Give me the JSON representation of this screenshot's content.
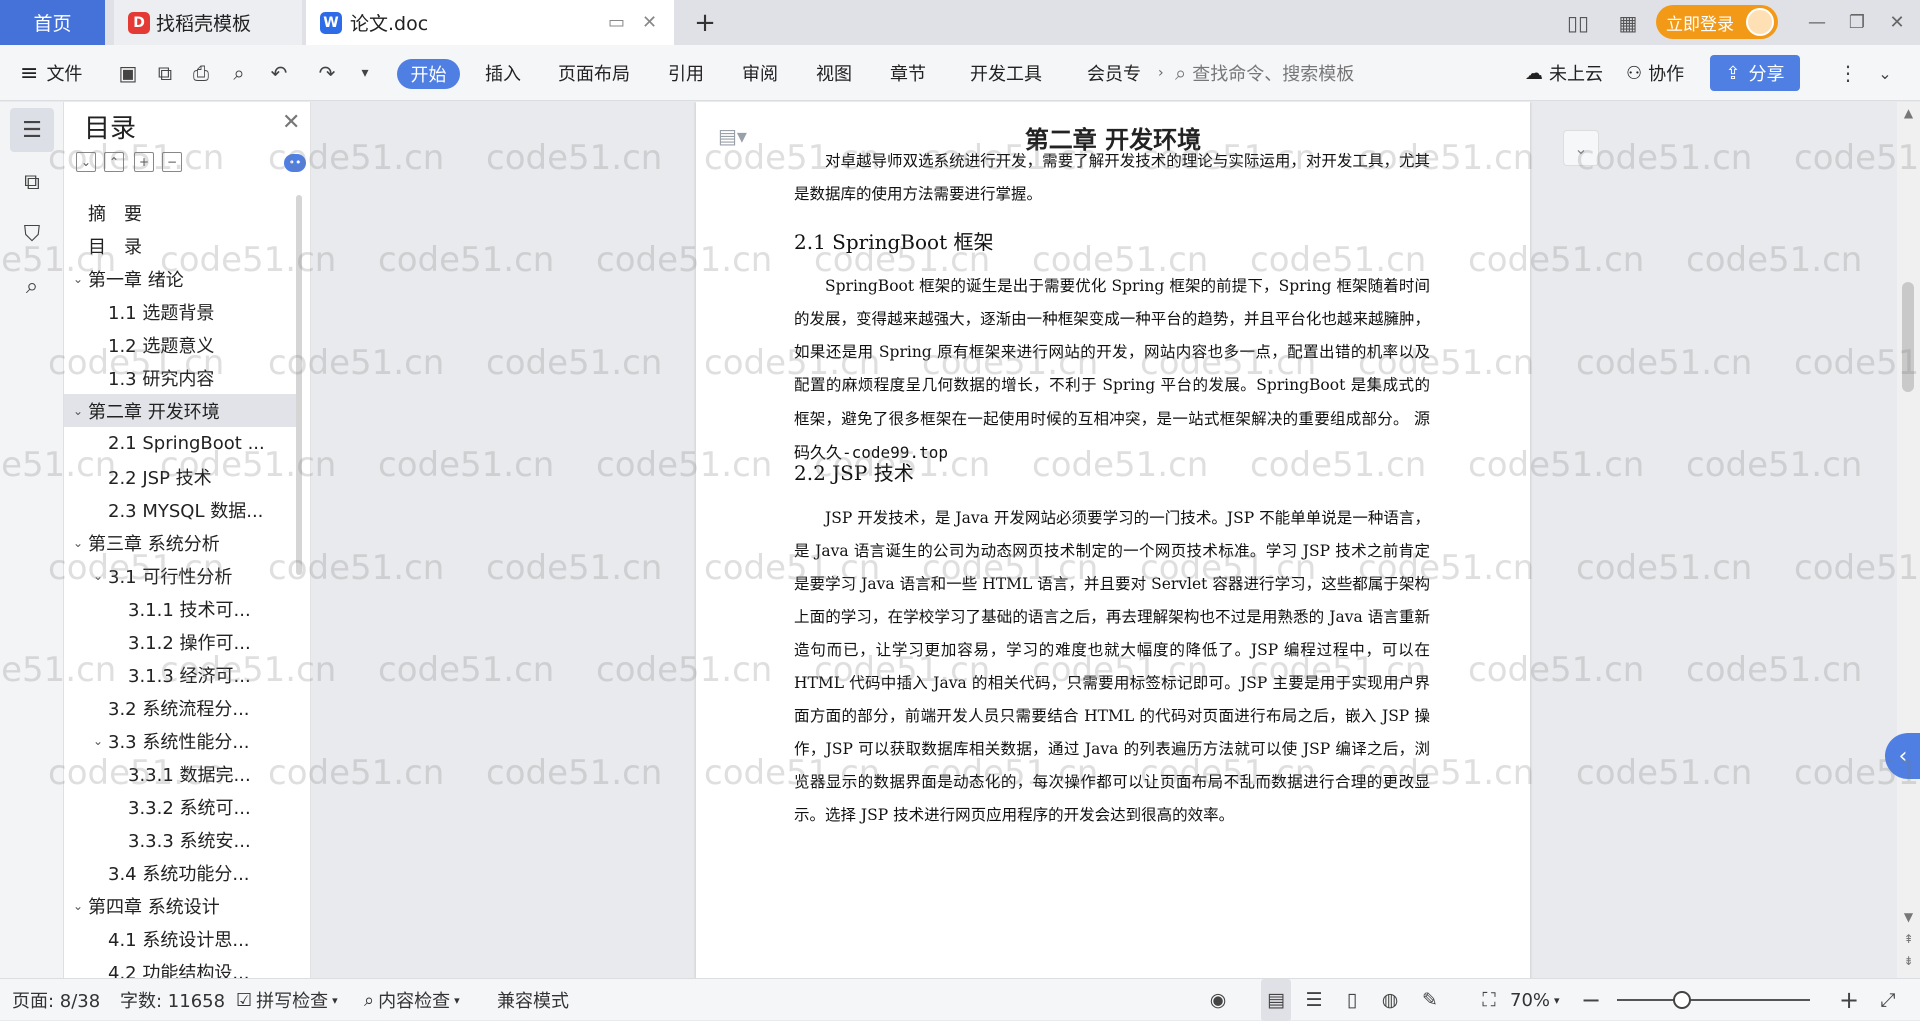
{
  "tabs": {
    "home": "首页",
    "template": "找稻壳模板",
    "doc": "论文.doc",
    "new_tab": "+",
    "login": "立即登录"
  },
  "ribbon": {
    "file": "文件",
    "tabs": [
      "开始",
      "插入",
      "页面布局",
      "引用",
      "审阅",
      "视图",
      "章节",
      "开发工具",
      "会员专"
    ],
    "search_placeholder": "查找命令、搜索模板",
    "cloud": "未上云",
    "collab": "协作",
    "share": "分享"
  },
  "toc": {
    "title": "目录",
    "items": [
      {
        "label": "摘　要",
        "level": 0,
        "caret": ""
      },
      {
        "label": "目　录",
        "level": 0,
        "caret": ""
      },
      {
        "label": "第一章 绪论",
        "level": 0,
        "caret": "v"
      },
      {
        "label": "1.1 选题背景",
        "level": 1,
        "caret": ""
      },
      {
        "label": "1.2 选题意义",
        "level": 1,
        "caret": ""
      },
      {
        "label": "1.3 研究内容",
        "level": 1,
        "caret": ""
      },
      {
        "label": "第二章 开发环境",
        "level": 0,
        "caret": "v",
        "selected": true
      },
      {
        "label": "2.1 SpringBoot ...",
        "level": 1,
        "caret": ""
      },
      {
        "label": "2.2 JSP 技术",
        "level": 1,
        "caret": ""
      },
      {
        "label": "2.3 MYSQL 数据...",
        "level": 1,
        "caret": ""
      },
      {
        "label": "第三章 系统分析",
        "level": 0,
        "caret": "v"
      },
      {
        "label": "3.1 可行性分析",
        "level": 1,
        "caret": "v"
      },
      {
        "label": "3.1.1 技术可...",
        "level": 2,
        "caret": ""
      },
      {
        "label": "3.1.2 操作可...",
        "level": 2,
        "caret": ""
      },
      {
        "label": "3.1.3 经济可...",
        "level": 2,
        "caret": ""
      },
      {
        "label": "3.2 系统流程分...",
        "level": 1,
        "caret": ""
      },
      {
        "label": "3.3 系统性能分...",
        "level": 1,
        "caret": "v"
      },
      {
        "label": "3.3.1 数据完...",
        "level": 2,
        "caret": ""
      },
      {
        "label": "3.3.2 系统可...",
        "level": 2,
        "caret": ""
      },
      {
        "label": "3.3.3 系统安...",
        "level": 2,
        "caret": ""
      },
      {
        "label": "3.4 系统功能分...",
        "level": 1,
        "caret": ""
      },
      {
        "label": "第四章 系统设计",
        "level": 0,
        "caret": "v"
      },
      {
        "label": "4.1 系统设计思...",
        "level": 1,
        "caret": ""
      },
      {
        "label": "4.2 功能结构设...",
        "level": 1,
        "caret": ""
      }
    ]
  },
  "document": {
    "chapter_title": "第二章  开发环境",
    "intro": "对卓越导师双选系统进行开发，需要了解开发技术的理论与实际运用，对开发工具，尤其是数据库的使用方法需要进行掌握。",
    "s1_title": "2.1 SpringBoot 框架",
    "s1_body": "SpringBoot 框架的诞生是出于需要优化 Spring 框架的前提下，Spring 框架随着时间的发展，变得越来越强大，逐渐由一种框架变成一种平台的趋势，并且平台化也越来越臃肿，如果还是用 Spring 原有框架来进行网站的开发，网站内容也多一点，配置出错的机率以及配置的麻烦程度呈几何数据的增长，不利于 Spring 平台的发展。SpringBoot 是集成式的框架，避免了很多框架在一起使用时候的互相冲突，是一站式框架解决的重要组成部分。",
    "s1_insert": "源码久久-code99.top",
    "s2_title": "2.2 JSP 技术",
    "s2_body": "JSP 开发技术，是 Java 开发网站必须要学习的一门技术。JSP 不能单单说是一种语言，是 Java 语言诞生的公司为动态网页技术制定的一个网页技术标准。学习 JSP 技术之前肯定是要学习 Java 语言和一些 HTML 语言，并且要对 Servlet 容器进行学习，这些都属于架构上面的学习，在学校学习了基础的语言之后，再去理解架构也不过是用熟悉的 Java 语言重新造句而已，让学习更加容易，学习的难度也就大幅度的降低了。JSP 编程过程中，可以在 HTML 代码中插入 Java 的相关代码，只需要用标签标记即可。JSP 主要是用于实现用户界面方面的部分，前端开发人员只需要结合 HTML 的代码对页面进行布局之后，嵌入 JSP 操作，JSP 可以获取数据库相关数据，通过 Java 的列表遍历方法就可以使 JSP 编译之后，浏览器显示的数据界面是动态化的，每次操作都可以让页面布局不乱而数据进行合理的更改显示。选择 JSP 技术进行网页应用程序的开发会达到很高的效率。"
  },
  "watermark": "code51.cn",
  "status": {
    "page": "页面: 8/38",
    "words": "字数: 11658",
    "spell": "拼写检查",
    "content": "内容检查",
    "compat": "兼容模式",
    "zoom": "70%",
    "zoom_percent": 70
  },
  "colors": {
    "accent": "#4f7fe3",
    "home_tab": "#4572d8",
    "login": "#f29a17"
  }
}
